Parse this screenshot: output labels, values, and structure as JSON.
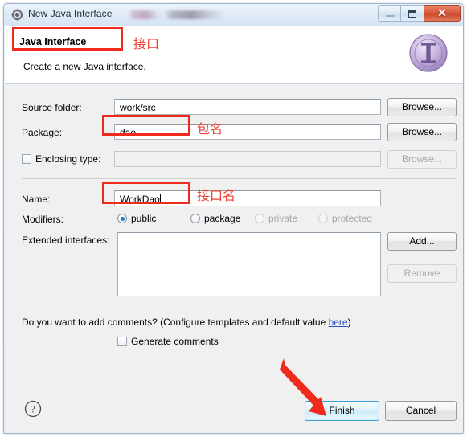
{
  "window": {
    "title": "New Java Interface",
    "icon": "java-interface-window-icon",
    "controls": {
      "minimize": "minimize",
      "maximize": "maximize",
      "close": "close"
    }
  },
  "header": {
    "title": "Java Interface",
    "subtitle": "Create a new Java interface.",
    "icon": "java-interface-banner-icon"
  },
  "form": {
    "source_folder": {
      "label": "Source folder:",
      "value": "work/src",
      "browse_label": "Browse..."
    },
    "package": {
      "label": "Package:",
      "value": "dao",
      "browse_label": "Browse..."
    },
    "enclosing_type": {
      "label": "Enclosing type:",
      "checked": false,
      "value": "",
      "browse_label": "Browse...",
      "disabled": true
    },
    "name": {
      "label": "Name:",
      "value": "WorkDao"
    },
    "modifiers": {
      "label": "Modifiers:",
      "options": [
        {
          "label": "public",
          "checked": true,
          "disabled": false
        },
        {
          "label": "package",
          "checked": false,
          "disabled": false
        },
        {
          "label": "private",
          "checked": false,
          "disabled": true
        },
        {
          "label": "protected",
          "checked": false,
          "disabled": true
        }
      ]
    },
    "extended_interfaces": {
      "label": "Extended interfaces:",
      "items": [],
      "add_label": "Add...",
      "remove_label": "Remove"
    },
    "comments": {
      "question_prefix": "Do you want to add comments? (Configure templates and default value ",
      "link_text": "here",
      "question_suffix": ")",
      "generate_label": "Generate comments",
      "generate_checked": false
    }
  },
  "footer": {
    "help_icon": "help-question-icon",
    "finish_label": "Finish",
    "cancel_label": "Cancel"
  },
  "annotations": {
    "interface": "接口",
    "package_name": "包名",
    "interface_name": "接口名",
    "box_color": "#ee2b1c",
    "text_color": "#ef4136",
    "arrow_color": "#ee2b1c"
  }
}
